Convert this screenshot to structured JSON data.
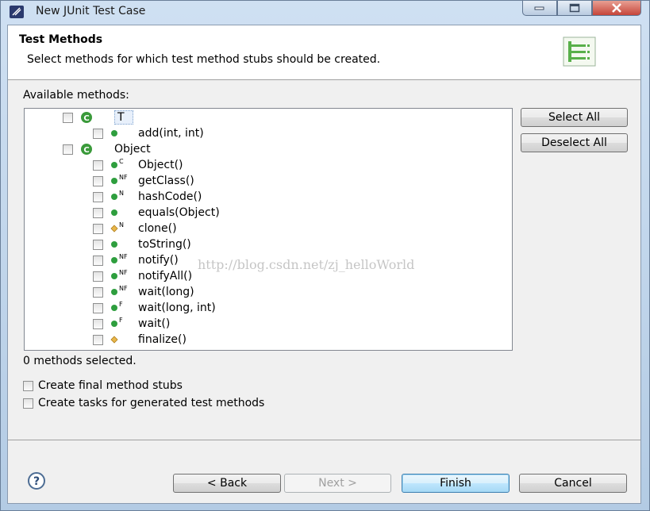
{
  "window": {
    "title": "New JUnit Test Case"
  },
  "header": {
    "title": "Test Methods",
    "description": "Select methods for which test method stubs should be created."
  },
  "available_label": "Available methods:",
  "tree": [
    {
      "label": "T",
      "kind": "class",
      "level": 0
    },
    {
      "label": "add(int, int)",
      "kind": "public",
      "level": 1,
      "modifiers": ""
    },
    {
      "label": "Object",
      "kind": "class",
      "level": 0
    },
    {
      "label": "Object()",
      "kind": "public",
      "level": 1,
      "modifiers": "C"
    },
    {
      "label": "getClass()",
      "kind": "public",
      "level": 1,
      "modifiers": "NF"
    },
    {
      "label": "hashCode()",
      "kind": "public",
      "level": 1,
      "modifiers": "N"
    },
    {
      "label": "equals(Object)",
      "kind": "public",
      "level": 1,
      "modifiers": ""
    },
    {
      "label": "clone()",
      "kind": "protected",
      "level": 1,
      "modifiers": "N"
    },
    {
      "label": "toString()",
      "kind": "public",
      "level": 1,
      "modifiers": ""
    },
    {
      "label": "notify()",
      "kind": "public",
      "level": 1,
      "modifiers": "NF"
    },
    {
      "label": "notifyAll()",
      "kind": "public",
      "level": 1,
      "modifiers": "NF"
    },
    {
      "label": "wait(long)",
      "kind": "public",
      "level": 1,
      "modifiers": "NF"
    },
    {
      "label": "wait(long, int)",
      "kind": "public",
      "level": 1,
      "modifiers": "F"
    },
    {
      "label": "wait()",
      "kind": "public",
      "level": 1,
      "modifiers": "F"
    },
    {
      "label": "finalize()",
      "kind": "protected",
      "level": 1,
      "modifiers": ""
    }
  ],
  "side_buttons": {
    "select_all": "Select All",
    "deselect_all": "Deselect All"
  },
  "status": "0 methods selected.",
  "options": {
    "final_stubs": "Create final method stubs",
    "tasks": "Create tasks for generated test methods"
  },
  "footer": {
    "back": "< Back",
    "next": "Next >",
    "finish": "Finish",
    "cancel": "Cancel"
  },
  "watermark": "http://blog.csdn.net/zj_helloWorld",
  "colors": {
    "public_icon": "#2e9e3e",
    "protected_icon": "#e8b64a",
    "class_icon": "#3a9a3a"
  }
}
